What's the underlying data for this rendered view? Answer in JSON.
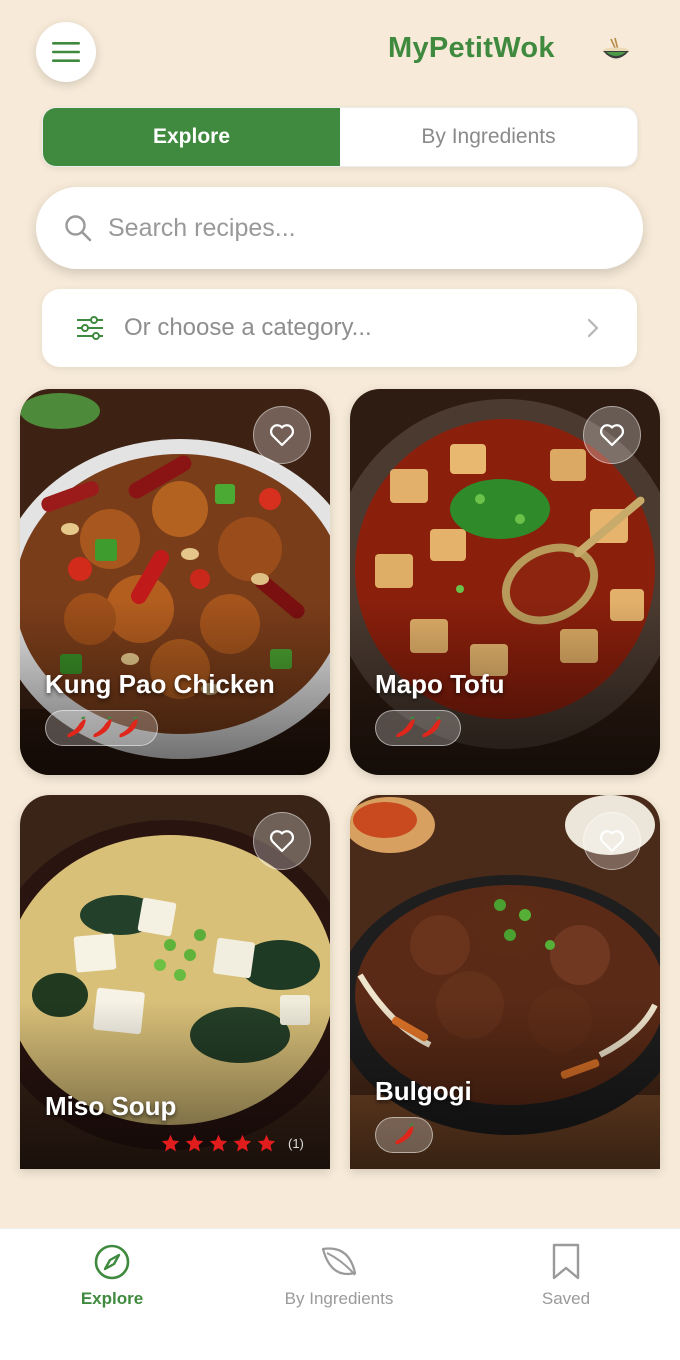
{
  "header": {
    "title": "MyPetitWok",
    "menu_icon": "hamburger-menu-icon",
    "logo_icon": "noodle-bowl-icon"
  },
  "tabs": [
    {
      "label": "Explore",
      "active": true
    },
    {
      "label": "By Ingredients",
      "active": false
    }
  ],
  "search": {
    "placeholder": "Search recipes..."
  },
  "category": {
    "placeholder": "Or choose a category..."
  },
  "recipes": [
    {
      "name": "Kung Pao Chicken",
      "spice_level": 3,
      "favorited": false
    },
    {
      "name": "Mapo Tofu",
      "spice_level": 2,
      "favorited": false
    },
    {
      "name": "Miso Soup",
      "rating": 5,
      "rating_count": "(1)",
      "favorited": false
    },
    {
      "name": "Bulgogi",
      "spice_level": 1,
      "favorited": false
    }
  ],
  "bottom_nav": [
    {
      "label": "Explore",
      "icon": "compass-icon",
      "active": true
    },
    {
      "label": "By Ingredients",
      "icon": "leaf-icon",
      "active": false
    },
    {
      "label": "Saved",
      "icon": "bookmark-icon",
      "active": false
    }
  ],
  "colors": {
    "background": "#f7ead8",
    "accent": "#3f8a3f",
    "star": "#e11d1d"
  }
}
